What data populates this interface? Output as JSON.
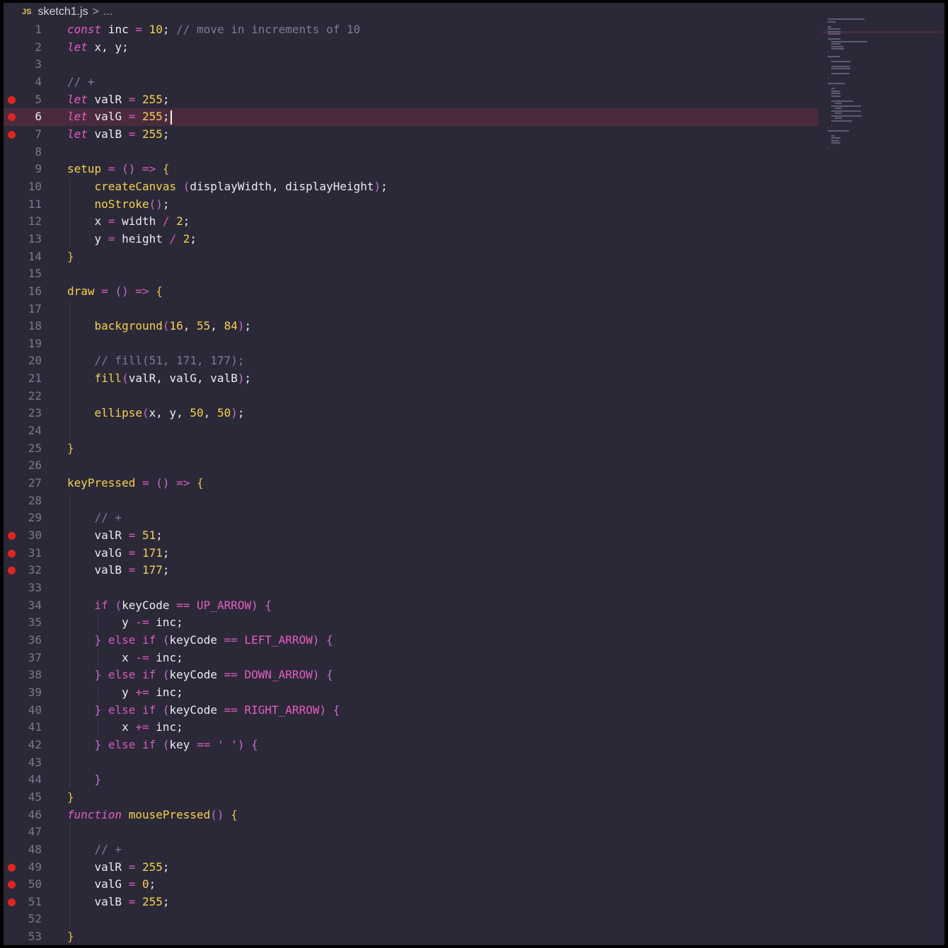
{
  "breadcrumb": {
    "icon": "JS",
    "file": "sketch1.js",
    "separator": ">",
    "more": "..."
  },
  "current_line": 6,
  "breakpoint_lines": [
    5,
    6,
    7,
    30,
    31,
    32,
    49,
    50,
    51
  ],
  "lines": [
    [
      [
        "kw",
        "const"
      ],
      [
        "pn",
        " inc "
      ],
      [
        "op",
        "="
      ],
      [
        "pn",
        " "
      ],
      [
        "num",
        "10"
      ],
      [
        "pn",
        "; "
      ],
      [
        "cm",
        "// move in increments of 10"
      ]
    ],
    [
      [
        "kw",
        "let"
      ],
      [
        "pn",
        " x, y;"
      ]
    ],
    [],
    [
      [
        "cm",
        "// +"
      ]
    ],
    [
      [
        "kw",
        "let"
      ],
      [
        "pn",
        " valR "
      ],
      [
        "op",
        "="
      ],
      [
        "pn",
        " "
      ],
      [
        "num",
        "255"
      ],
      [
        "pn",
        ";"
      ]
    ],
    [
      [
        "kw",
        "let"
      ],
      [
        "pn",
        " valG "
      ],
      [
        "op",
        "="
      ],
      [
        "pn",
        " "
      ],
      [
        "num",
        "255"
      ],
      [
        "pn",
        ";"
      ]
    ],
    [
      [
        "kw",
        "let"
      ],
      [
        "pn",
        " valB "
      ],
      [
        "op",
        "="
      ],
      [
        "pn",
        " "
      ],
      [
        "num",
        "255"
      ],
      [
        "pn",
        ";"
      ]
    ],
    [],
    [
      [
        "fn",
        "setup"
      ],
      [
        "pn",
        " "
      ],
      [
        "op",
        "="
      ],
      [
        "pn",
        " "
      ],
      [
        "par",
        "()"
      ],
      [
        "pn",
        " "
      ],
      [
        "op",
        "=>"
      ],
      [
        "pn",
        " "
      ],
      [
        "brace",
        "{"
      ]
    ],
    [
      [
        "pn",
        "    "
      ],
      [
        "fn",
        "createCanvas"
      ],
      [
        "pn",
        " "
      ],
      [
        "par",
        "("
      ],
      [
        "pn",
        "displayWidth, displayHeight"
      ],
      [
        "par",
        ")"
      ],
      [
        "pn",
        ";"
      ]
    ],
    [
      [
        "pn",
        "    "
      ],
      [
        "fn",
        "noStroke"
      ],
      [
        "par",
        "()"
      ],
      [
        "pn",
        ";"
      ]
    ],
    [
      [
        "pn",
        "    x "
      ],
      [
        "op",
        "="
      ],
      [
        "pn",
        " width "
      ],
      [
        "op",
        "/"
      ],
      [
        "pn",
        " "
      ],
      [
        "num",
        "2"
      ],
      [
        "pn",
        ";"
      ]
    ],
    [
      [
        "pn",
        "    y "
      ],
      [
        "op",
        "="
      ],
      [
        "pn",
        " height "
      ],
      [
        "op",
        "/"
      ],
      [
        "pn",
        " "
      ],
      [
        "num",
        "2"
      ],
      [
        "pn",
        ";"
      ]
    ],
    [
      [
        "brace",
        "}"
      ]
    ],
    [],
    [
      [
        "fn",
        "draw"
      ],
      [
        "pn",
        " "
      ],
      [
        "op",
        "="
      ],
      [
        "pn",
        " "
      ],
      [
        "par",
        "()"
      ],
      [
        "pn",
        " "
      ],
      [
        "op",
        "=>"
      ],
      [
        "pn",
        " "
      ],
      [
        "brace",
        "{"
      ]
    ],
    [],
    [
      [
        "pn",
        "    "
      ],
      [
        "fn",
        "background"
      ],
      [
        "par",
        "("
      ],
      [
        "num",
        "16"
      ],
      [
        "pn",
        ", "
      ],
      [
        "num",
        "55"
      ],
      [
        "pn",
        ", "
      ],
      [
        "num",
        "84"
      ],
      [
        "par",
        ")"
      ],
      [
        "pn",
        ";"
      ]
    ],
    [],
    [
      [
        "pn",
        "    "
      ],
      [
        "cm",
        "// fill(51, 171, 177);"
      ]
    ],
    [
      [
        "pn",
        "    "
      ],
      [
        "fn",
        "fill"
      ],
      [
        "par",
        "("
      ],
      [
        "pn",
        "valR, valG, valB"
      ],
      [
        "par",
        ")"
      ],
      [
        "pn",
        ";"
      ]
    ],
    [],
    [
      [
        "pn",
        "    "
      ],
      [
        "fn",
        "ellipse"
      ],
      [
        "par",
        "("
      ],
      [
        "pn",
        "x, y, "
      ],
      [
        "num",
        "50"
      ],
      [
        "pn",
        ", "
      ],
      [
        "num",
        "50"
      ],
      [
        "par",
        ")"
      ],
      [
        "pn",
        ";"
      ]
    ],
    [],
    [
      [
        "brace",
        "}"
      ]
    ],
    [],
    [
      [
        "fn",
        "keyPressed"
      ],
      [
        "pn",
        " "
      ],
      [
        "op",
        "="
      ],
      [
        "pn",
        " "
      ],
      [
        "par",
        "()"
      ],
      [
        "pn",
        " "
      ],
      [
        "op",
        "=>"
      ],
      [
        "pn",
        " "
      ],
      [
        "brace",
        "{"
      ]
    ],
    [],
    [
      [
        "pn",
        "    "
      ],
      [
        "cm",
        "// +"
      ]
    ],
    [
      [
        "pn",
        "    valR "
      ],
      [
        "op",
        "="
      ],
      [
        "pn",
        " "
      ],
      [
        "num",
        "51"
      ],
      [
        "pn",
        ";"
      ]
    ],
    [
      [
        "pn",
        "    valG "
      ],
      [
        "op",
        "="
      ],
      [
        "pn",
        " "
      ],
      [
        "num",
        "171"
      ],
      [
        "pn",
        ";"
      ]
    ],
    [
      [
        "pn",
        "    valB "
      ],
      [
        "op",
        "="
      ],
      [
        "pn",
        " "
      ],
      [
        "num",
        "177"
      ],
      [
        "pn",
        ";"
      ]
    ],
    [],
    [
      [
        "pn",
        "    "
      ],
      [
        "kwp",
        "if"
      ],
      [
        "pn",
        " "
      ],
      [
        "par",
        "("
      ],
      [
        "pn",
        "keyCode "
      ],
      [
        "op",
        "=="
      ],
      [
        "pn",
        " "
      ],
      [
        "cst",
        "UP_ARROW"
      ],
      [
        "par",
        ")"
      ],
      [
        "pn",
        " "
      ],
      [
        "par",
        "{"
      ]
    ],
    [
      [
        "pn",
        "        y "
      ],
      [
        "op",
        "-="
      ],
      [
        "pn",
        " inc;"
      ]
    ],
    [
      [
        "pn",
        "    "
      ],
      [
        "par",
        "}"
      ],
      [
        "pn",
        " "
      ],
      [
        "kwp",
        "else if"
      ],
      [
        "pn",
        " "
      ],
      [
        "par",
        "("
      ],
      [
        "pn",
        "keyCode "
      ],
      [
        "op",
        "=="
      ],
      [
        "pn",
        " "
      ],
      [
        "cst",
        "LEFT_ARROW"
      ],
      [
        "par",
        ")"
      ],
      [
        "pn",
        " "
      ],
      [
        "par",
        "{"
      ]
    ],
    [
      [
        "pn",
        "        x "
      ],
      [
        "op",
        "-="
      ],
      [
        "pn",
        " inc;"
      ]
    ],
    [
      [
        "pn",
        "    "
      ],
      [
        "par",
        "}"
      ],
      [
        "pn",
        " "
      ],
      [
        "kwp",
        "else if"
      ],
      [
        "pn",
        " "
      ],
      [
        "par",
        "("
      ],
      [
        "pn",
        "keyCode "
      ],
      [
        "op",
        "=="
      ],
      [
        "pn",
        " "
      ],
      [
        "cst",
        "DOWN_ARROW"
      ],
      [
        "par",
        ")"
      ],
      [
        "pn",
        " "
      ],
      [
        "par",
        "{"
      ]
    ],
    [
      [
        "pn",
        "        y "
      ],
      [
        "op",
        "+="
      ],
      [
        "pn",
        " inc;"
      ]
    ],
    [
      [
        "pn",
        "    "
      ],
      [
        "par",
        "}"
      ],
      [
        "pn",
        " "
      ],
      [
        "kwp",
        "else if"
      ],
      [
        "pn",
        " "
      ],
      [
        "par",
        "("
      ],
      [
        "pn",
        "keyCode "
      ],
      [
        "op",
        "=="
      ],
      [
        "pn",
        " "
      ],
      [
        "cst",
        "RIGHT_ARROW"
      ],
      [
        "par",
        ")"
      ],
      [
        "pn",
        " "
      ],
      [
        "par",
        "{"
      ]
    ],
    [
      [
        "pn",
        "        x "
      ],
      [
        "op",
        "+="
      ],
      [
        "pn",
        " inc;"
      ]
    ],
    [
      [
        "pn",
        "    "
      ],
      [
        "par",
        "}"
      ],
      [
        "pn",
        " "
      ],
      [
        "kwp",
        "else if"
      ],
      [
        "pn",
        " "
      ],
      [
        "par",
        "("
      ],
      [
        "pn",
        "key "
      ],
      [
        "op",
        "=="
      ],
      [
        "pn",
        " "
      ],
      [
        "cst",
        "' '"
      ],
      [
        "par",
        ")"
      ],
      [
        "pn",
        " "
      ],
      [
        "par",
        "{"
      ]
    ],
    [],
    [
      [
        "pn",
        "    "
      ],
      [
        "par",
        "}"
      ]
    ],
    [
      [
        "brace",
        "}"
      ]
    ],
    [
      [
        "kw",
        "function"
      ],
      [
        "pn",
        " "
      ],
      [
        "fn",
        "mousePressed"
      ],
      [
        "par",
        "()"
      ],
      [
        "pn",
        " "
      ],
      [
        "brace",
        "{"
      ]
    ],
    [],
    [
      [
        "pn",
        "    "
      ],
      [
        "cm",
        "// +"
      ]
    ],
    [
      [
        "pn",
        "    valR "
      ],
      [
        "op",
        "="
      ],
      [
        "pn",
        " "
      ],
      [
        "num",
        "255"
      ],
      [
        "pn",
        ";"
      ]
    ],
    [
      [
        "pn",
        "    valG "
      ],
      [
        "op",
        "="
      ],
      [
        "pn",
        " "
      ],
      [
        "num",
        "0"
      ],
      [
        "pn",
        ";"
      ]
    ],
    [
      [
        "pn",
        "    valB "
      ],
      [
        "op",
        "="
      ],
      [
        "pn",
        " "
      ],
      [
        "num",
        "255"
      ],
      [
        "pn",
        ";"
      ]
    ],
    [],
    [
      [
        "brace",
        "}"
      ]
    ]
  ]
}
